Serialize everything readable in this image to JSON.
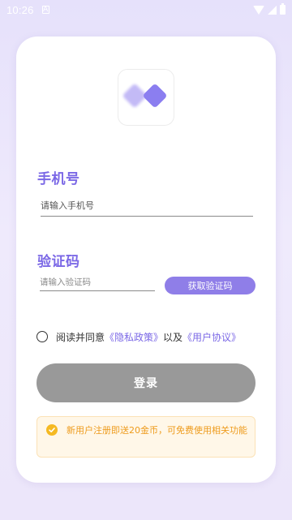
{
  "status_bar": {
    "time": "10:26",
    "notification_glyph": "A",
    "icons": [
      "wifi-icon",
      "signal-icon",
      "battery-icon"
    ]
  },
  "logo": {
    "icon": "overlapping-diamonds-logo",
    "colors": {
      "front": "#8b7ef0",
      "back": "#b9aef5"
    }
  },
  "phone": {
    "label": "手机号",
    "placeholder": "请输入手机号"
  },
  "code": {
    "label": "验证码",
    "placeholder": "请输入验证码",
    "button_label": "获取验证码"
  },
  "agreement": {
    "prefix": "阅读并同意",
    "privacy_link": "《隐私政策》",
    "middle": "以及",
    "user_link": "《用户协议》",
    "checked": false
  },
  "login_button_label": "登录",
  "notice": {
    "icon": "check-circle-icon",
    "text": "新用户注册即送20金币，可免费使用相关功能"
  },
  "colors": {
    "accent": "#7b68e6",
    "button_secondary": "#8f7ee8",
    "login_disabled": "#999999",
    "notice_text": "#ee9b1c",
    "notice_bg": "#fff7e8"
  }
}
